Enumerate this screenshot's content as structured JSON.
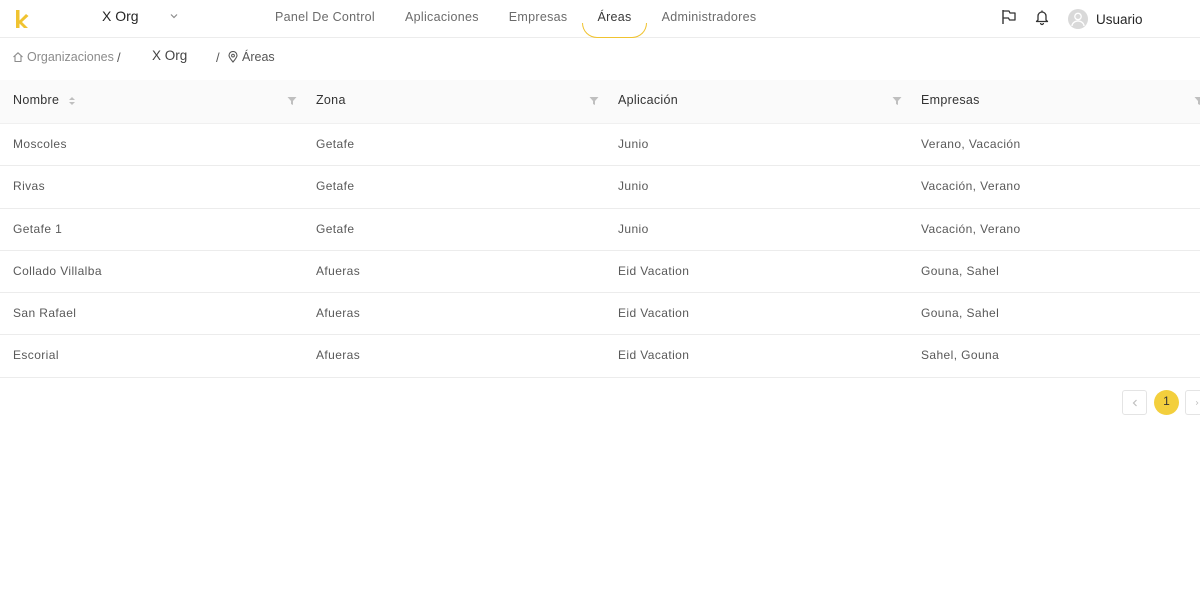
{
  "colors": {
    "accent": "#f3cf3d",
    "logo": "#f0c330",
    "text": "#595959",
    "header_bg": "#fafafa"
  },
  "header": {
    "org_select": {
      "value": "X Org",
      "icon": "chevron-down-icon"
    },
    "nav": [
      {
        "label": "Panel De Control"
      },
      {
        "label": "Aplicaciones"
      },
      {
        "label": "Empresas"
      },
      {
        "label": "Áreas",
        "active": true
      },
      {
        "label": "Administradores"
      }
    ],
    "icons": [
      "flag-icon",
      "bell-icon",
      "user-icon"
    ],
    "user_name": "Usuario"
  },
  "breadcrumb": {
    "root": "Organizaciones",
    "separator": "/",
    "org": "X Org",
    "current": "Áreas"
  },
  "table": {
    "columns": [
      "Nombre",
      "Zona",
      "Aplicación",
      "Empresas"
    ],
    "rows": [
      [
        "Moscoles",
        "Getafe",
        "Junio",
        "Verano, Vacación"
      ],
      [
        "Rivas",
        "Getafe",
        "Junio",
        "Vacación, Verano"
      ],
      [
        "Getafe 1",
        "Getafe",
        "Junio",
        "Vacación, Verano"
      ],
      [
        "Collado Villalba",
        "Afueras",
        "Eid Vacation",
        "Gouna, Sahel"
      ],
      [
        "San Rafael",
        "Afueras",
        "Eid Vacation",
        "Gouna, Sahel"
      ],
      [
        "Escorial",
        "Afueras",
        "Eid Vacation",
        "Sahel, Gouna"
      ]
    ]
  },
  "pagination": {
    "current_page": "1"
  }
}
